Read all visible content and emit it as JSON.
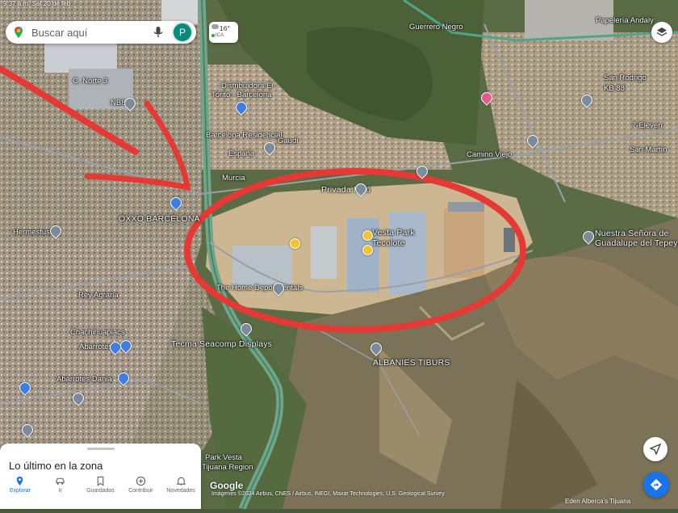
{
  "status_bar": {
    "time": "9:37 a.m.  Sat 20 de feb"
  },
  "search": {
    "placeholder": "Buscar aquí",
    "avatar_letter": "P"
  },
  "weather": {
    "temp": "16°",
    "aqi": "ICA"
  },
  "labels": {
    "c_norte": "C. Norte 3",
    "nb8": "NB8",
    "distribuidora": "Distribuidora El",
    "torito": "Torito - Barcelona",
    "barcelona_res": "Barcelona Residencial",
    "espana": "España",
    "gaudi": "Gaudí",
    "murcia": "Murcia",
    "privada_miro": "Privada Miró",
    "oxxo": "OXXO BARCELONA",
    "vesta": "Vesta Park",
    "tecolote": "Tecolote",
    "home_depot": "The Home Depot Rentals",
    "tecma": "Tecma Seacomp Displays",
    "albanies": "ALBANIES TIBURS",
    "abarrotes_azel": "Abarrotes Azel",
    "abarrotes_dania": "Abarrotes Dania",
    "rey_agraria": "Rey Agraria",
    "chachihuapiaca": "Chachihuapiacs",
    "guerrero_negro": "Guerrero Negro",
    "papeleria": "Papelería Andaly",
    "san_rodrigo": "San Rodrigo",
    "kb88": "KB 88",
    "el_elevent": "7-Eleven",
    "san_martin": "San Martín",
    "nuestra_senora": "Nuestra Señora de",
    "guadalupe": "Guadalupe del Tepeyac",
    "hermesfusion": "Hermesfusión",
    "park_vesta": "Park Vesta",
    "tijuana_region": "Tijuana Region",
    "calle_chilpancingo": "Camino Viejo"
  },
  "bottom_sheet": {
    "title": "Lo último en la zona"
  },
  "tabs": [
    {
      "label": "Explorar",
      "icon": "pin-icon",
      "active": true
    },
    {
      "label": "Ir",
      "icon": "car-icon",
      "active": false
    },
    {
      "label": "Guardados",
      "icon": "bookmark-icon",
      "active": false
    },
    {
      "label": "Contribuir",
      "icon": "plus-circle-icon",
      "active": false
    },
    {
      "label": "Novedades",
      "icon": "bell-icon",
      "active": false
    }
  ],
  "attribution": {
    "logo": "Google",
    "text": "Imágenes ©2024 Airbus, CNES / Airbus, INEGI, Maxar Technologies, U.S. Geological Survey"
  },
  "corner_label": "Eden Alberca's Tijuana",
  "colors": {
    "annotation_red": "#e53935",
    "accent_blue": "#1a73e8"
  }
}
